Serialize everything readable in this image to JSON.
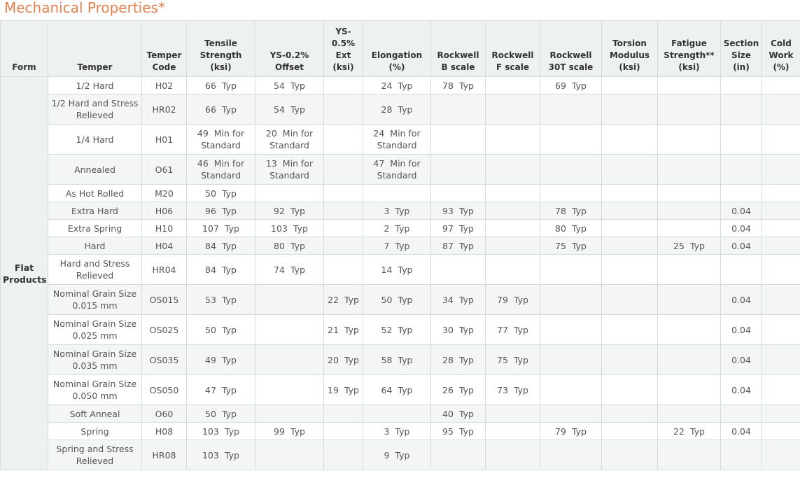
{
  "title": "Mechanical Properties*",
  "headers": [
    "Form",
    "Temper",
    "Temper Code",
    "Tensile Strength (ksi)",
    "YS-0.2% Offset",
    "YS-0.5% Ext (ksi)",
    "Elongation (%)",
    "Rockwell B scale",
    "Rockwell F scale",
    "Rockwell 30T scale",
    "Torsion Modulus (ksi)",
    "Fatigue Strength** (ksi)",
    "Section Size (in)",
    "Cold Work (%)"
  ],
  "form": "Flat Products",
  "rows": [
    {
      "temper": "1/2 Hard",
      "code": "H02",
      "cells": [
        "66|Typ",
        "54|Typ",
        "",
        "24|Typ",
        "78|Typ",
        "",
        "69|Typ",
        "",
        "",
        "",
        ""
      ]
    },
    {
      "temper": "1/2 Hard and Stress Relieved",
      "code": "HR02",
      "cells": [
        "66|Typ",
        "54|Typ",
        "",
        "28|Typ",
        "",
        "",
        "",
        "",
        "",
        "",
        ""
      ]
    },
    {
      "temper": "1/4 Hard",
      "code": "H01",
      "cells": [
        "49|Min for Standard",
        "20|Min for Standard",
        "",
        "24|Min for Standard",
        "",
        "",
        "",
        "",
        "",
        "",
        ""
      ]
    },
    {
      "temper": "Annealed",
      "code": "O61",
      "cells": [
        "46|Min for Standard",
        "13|Min for Standard",
        "",
        "47|Min for Standard",
        "",
        "",
        "",
        "",
        "",
        "",
        ""
      ]
    },
    {
      "temper": "As Hot Rolled",
      "code": "M20",
      "cells": [
        "50|Typ",
        "",
        "",
        "",
        "",
        "",
        "",
        "",
        "",
        "",
        ""
      ]
    },
    {
      "temper": "Extra Hard",
      "code": "H06",
      "cells": [
        "96|Typ",
        "92|Typ",
        "",
        "3|Typ",
        "93|Typ",
        "",
        "78|Typ",
        "",
        "",
        "0.04",
        ""
      ]
    },
    {
      "temper": "Extra Spring",
      "code": "H10",
      "cells": [
        "107|Typ",
        "103|Typ",
        "",
        "2|Typ",
        "97|Typ",
        "",
        "80|Typ",
        "",
        "",
        "0.04",
        ""
      ]
    },
    {
      "temper": "Hard",
      "code": "H04",
      "cells": [
        "84|Typ",
        "80|Typ",
        "",
        "7|Typ",
        "87|Typ",
        "",
        "75|Typ",
        "",
        "25|Typ",
        "0.04",
        ""
      ]
    },
    {
      "temper": "Hard and Stress Relieved",
      "code": "HR04",
      "cells": [
        "84|Typ",
        "74|Typ",
        "",
        "14|Typ",
        "",
        "",
        "",
        "",
        "",
        "",
        ""
      ]
    },
    {
      "temper": "Nominal Grain Size 0.015 mm",
      "code": "OS015",
      "cells": [
        "53|Typ",
        "",
        "22|Typ",
        "50|Typ",
        "34|Typ",
        "79|Typ",
        "",
        "",
        "",
        "0.04",
        ""
      ]
    },
    {
      "temper": "Nominal Grain Size 0.025 mm",
      "code": "OS025",
      "cells": [
        "50|Typ",
        "",
        "21|Typ",
        "52|Typ",
        "30|Typ",
        "77|Typ",
        "",
        "",
        "",
        "0.04",
        ""
      ]
    },
    {
      "temper": "Nominal Grain Size 0.035 mm",
      "code": "OS035",
      "cells": [
        "49|Typ",
        "",
        "20|Typ",
        "58|Typ",
        "28|Typ",
        "75|Typ",
        "",
        "",
        "",
        "0.04",
        ""
      ]
    },
    {
      "temper": "Nominal Grain Size 0.050 mm",
      "code": "OS050",
      "cells": [
        "47|Typ",
        "",
        "19|Typ",
        "64|Typ",
        "26|Typ",
        "73|Typ",
        "",
        "",
        "",
        "0.04",
        ""
      ]
    },
    {
      "temper": "Soft Anneal",
      "code": "O60",
      "cells": [
        "50|Typ",
        "",
        "",
        "",
        "40|Typ",
        "",
        "",
        "",
        "",
        "",
        ""
      ]
    },
    {
      "temper": "Spring",
      "code": "H08",
      "cells": [
        "103|Typ",
        "99|Typ",
        "",
        "3|Typ",
        "95|Typ",
        "",
        "79|Typ",
        "",
        "22|Typ",
        "0.04",
        ""
      ]
    },
    {
      "temper": "Spring and Stress Relieved",
      "code": "HR08",
      "cells": [
        "103|Typ",
        "",
        "",
        "9|Typ",
        "",
        "",
        "",
        "",
        "",
        "",
        ""
      ]
    }
  ]
}
